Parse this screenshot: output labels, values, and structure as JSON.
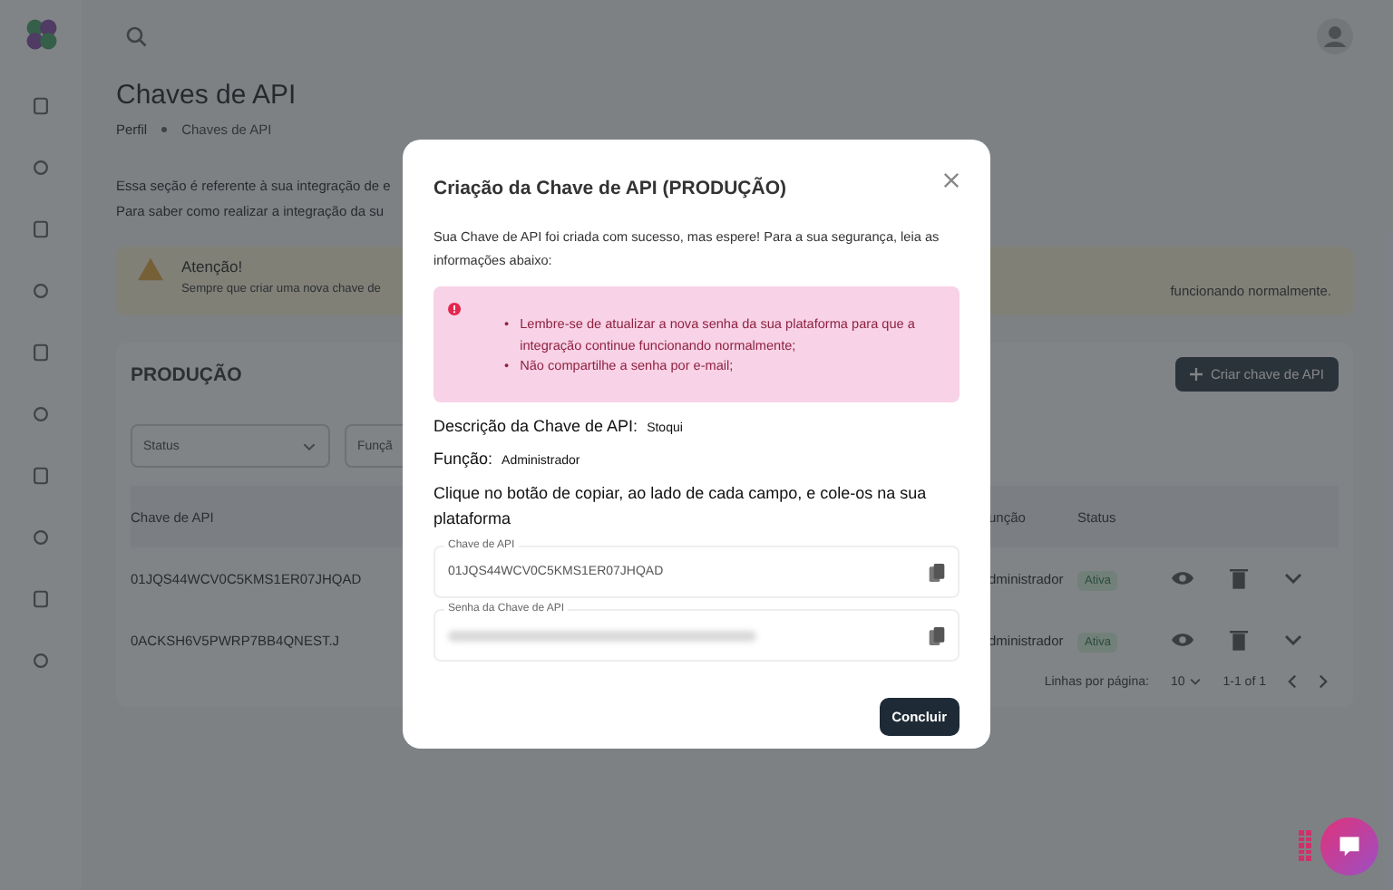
{
  "page": {
    "title": "Chaves de API",
    "breadcrumb": [
      "Perfil",
      "Chaves de API"
    ],
    "description": [
      "Essa seção é referente à sua integração de e",
      "Para saber como realizar a integração da su"
    ]
  },
  "alert": {
    "title": "Atenção!",
    "text_start": "Sempre que criar uma nova chave de",
    "text_end": "funcionando normalmente."
  },
  "section": {
    "title": "PRODUÇÃO",
    "create_button": "Criar chave de API"
  },
  "filters": [
    {
      "placeholder": "Status"
    },
    {
      "placeholder": "Funçã"
    }
  ],
  "table": {
    "columns": [
      "Chave de API",
      "unção",
      "Status"
    ],
    "rows": [
      {
        "key": "01JQS44WCV0C5KMS1ER07JHQAD",
        "role": "dministrador",
        "status": "Ativa"
      },
      {
        "key": "0ACKSH6V5PWRP7BB4QNEST.J",
        "role": "dministrador",
        "status": "Ativa"
      }
    ],
    "pagination": {
      "rows_label": "Linhas por página:",
      "rows_value": "10",
      "range": "1-1 of 1"
    }
  },
  "modal": {
    "title": "Criação da Chave de API (PRODUÇÃO)",
    "intro": "Sua Chave de API foi criada com sucesso, mas espere! Para a sua segurança, leia as informações abaixo:",
    "bullet": "•",
    "warnings": [
      "Lembre-se de atualizar a nova senha da sua plataforma para que a integração continue funcionando normalmente;",
      "Não compartilhe a senha por e-mail;"
    ],
    "details": [
      {
        "label": "Descrição da Chave de API:",
        "value": "Stoqui"
      },
      {
        "label": "Função:",
        "value": "Administrador"
      }
    ],
    "instruction": "Clique no botão de copiar, ao lado de cada campo, e cole-os na sua plataforma",
    "fields": [
      {
        "kind": "text",
        "label": "Chave de API",
        "value": "01JQS44WCV0C5KMS1ER07JHQAD"
      },
      {
        "kind": "blurred",
        "label": "Senha da Chave de API"
      }
    ],
    "confirm_button": "Concluir"
  }
}
